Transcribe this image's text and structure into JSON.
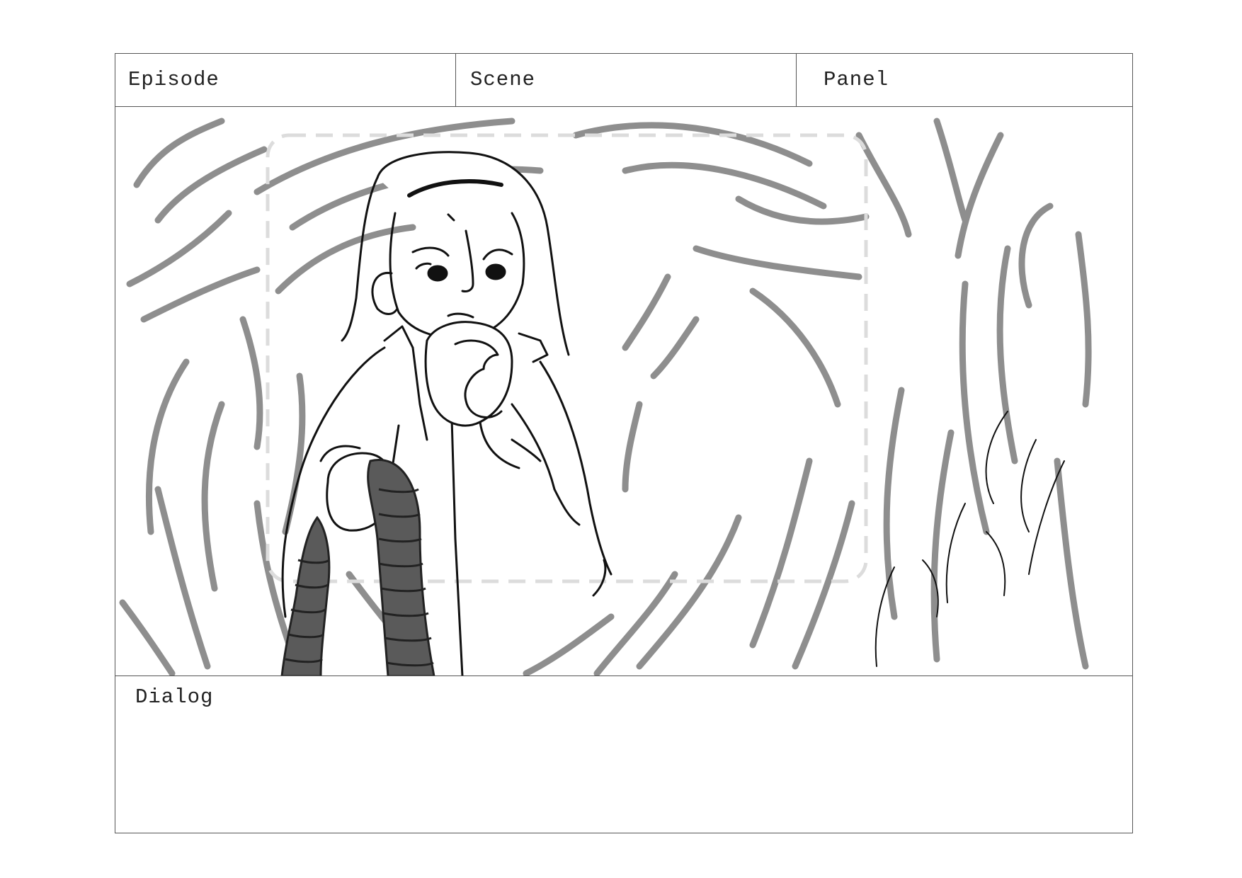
{
  "header": {
    "episode_label": "Episode",
    "scene_label": "Scene",
    "panel_label": "Panel"
  },
  "dialog": {
    "label": "Dialog"
  }
}
